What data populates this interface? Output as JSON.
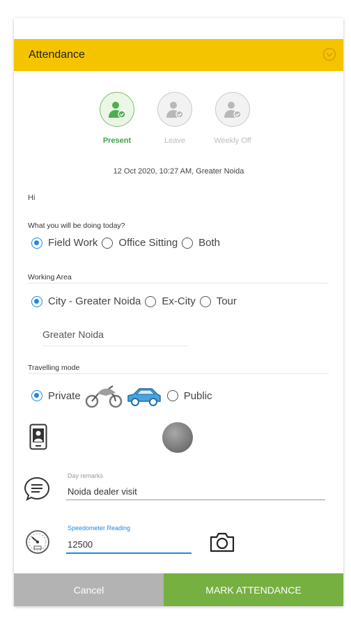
{
  "header": {
    "title": "Attendance"
  },
  "status": [
    {
      "label": "Present",
      "active": true
    },
    {
      "label": "Leave",
      "active": false
    },
    {
      "label": "Weekly Off",
      "active": false
    }
  ],
  "date_line": "12 Oct 2020, 10:27 AM, Greater Noida",
  "greeting": "Hi",
  "activity": {
    "label": "What you will be doing today?",
    "options": [
      "Field Work",
      "Office Sitting",
      "Both"
    ],
    "selected": "Field Work"
  },
  "working_area": {
    "label": "Working Area",
    "options": [
      "City - Greater Noida",
      "Ex-City",
      "Tour"
    ],
    "selected": "City - Greater Noida",
    "city_value": "Greater Noida"
  },
  "travelling_mode": {
    "label": "Travelling mode",
    "options": [
      "Private",
      "Public"
    ],
    "selected": "Private"
  },
  "remarks": {
    "label": "Day remarks",
    "value": "Noida dealer visit"
  },
  "speedometer": {
    "label": "Speedometer Reading",
    "value": "12500"
  },
  "buttons": {
    "cancel": "Cancel",
    "mark": "MARK ATTENDANCE"
  },
  "colors": {
    "header": "#f5c400",
    "accent_blue": "#1e88e5",
    "green": "#76b041",
    "present_green": "#43a047"
  }
}
